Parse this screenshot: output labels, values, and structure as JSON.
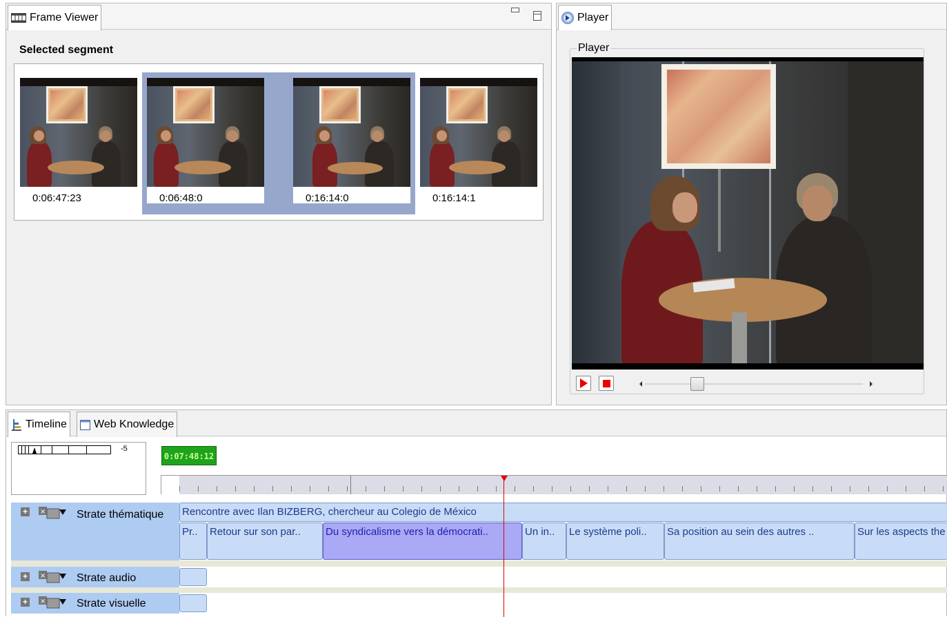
{
  "frame_viewer": {
    "tab_label": "Frame Viewer",
    "section_title": "Selected segment",
    "frames": [
      {
        "time": "0:06:47:23",
        "selected": false
      },
      {
        "time": "0:06:48:0",
        "selected": true
      },
      {
        "time": "0:16:14:0",
        "selected": true
      },
      {
        "time": "0:16:14:1",
        "selected": false
      }
    ]
  },
  "player": {
    "tab_label": "Player",
    "group_label": "Player",
    "progress": 0.24
  },
  "bottom_tabs": {
    "timeline": "Timeline",
    "web_knowledge": "Web Knowledge"
  },
  "timeline": {
    "zoom_value": "-5",
    "current_time": "0:07:48:12",
    "strates": [
      {
        "label": "Strate thématique",
        "top_segment": "Rencontre avec Ilan BIZBERG, chercheur au Colegio de México",
        "segments": [
          {
            "label": "Pr..",
            "selected": false
          },
          {
            "label": "Retour sur son par..",
            "selected": false
          },
          {
            "label": "Du syndicalisme vers la démocrati..",
            "selected": true
          },
          {
            "label": "Un in..",
            "selected": false
          },
          {
            "label": "Le système poli..",
            "selected": false
          },
          {
            "label": "Sa position au sein des autres ..",
            "selected": false
          },
          {
            "label": "Sur les aspects the",
            "selected": false
          }
        ]
      },
      {
        "label": "Strate audio"
      },
      {
        "label": "Strate visuelle"
      }
    ]
  },
  "colors": {
    "time_display_bg": "#1fa31f",
    "time_display_text": "#c8ff8a",
    "selection": "#97a7cc",
    "strate_header": "#aecbf2",
    "segment": "#c9dcf7",
    "segment_selected": "#a9a9f5",
    "playhead": "#e00000"
  }
}
